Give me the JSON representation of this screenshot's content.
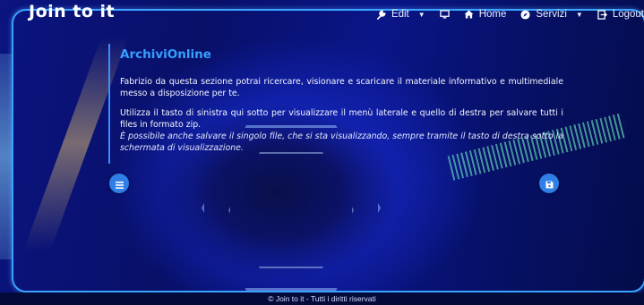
{
  "brand": {
    "name": "Join to it"
  },
  "navbar": {
    "items": [
      {
        "label": "Edit",
        "icon": "wrench-icon",
        "dropdown": true
      },
      {
        "label": "",
        "icon": "monitor-icon",
        "dropdown": false
      },
      {
        "label": "Home",
        "icon": "home-icon",
        "dropdown": false
      },
      {
        "label": "Servizi",
        "icon": "compass-icon",
        "dropdown": true
      },
      {
        "label": "Logout",
        "icon": "logout-icon",
        "dropdown": false
      }
    ]
  },
  "content": {
    "title": "ArchiviOnline",
    "paragraph1": "Fabrizio da questa sezione potrai ricercare, visionare e scaricare il materiale informativo e multimediale messo a disposizione per te.",
    "paragraph2": "Utilizza il tasto di sinistra qui sotto per visualizzare il menù laterale e quello di destra per salvare tutti i files in formato zip.",
    "paragraph3": "È possibile anche salvare il singolo file, che si sta visualizzando, sempre tramite il tasto di destra sotto la schermata di visualizzazione."
  },
  "buttons": {
    "left": {
      "icon": "menu-icon"
    },
    "right": {
      "icon": "save-icon"
    }
  },
  "footer": {
    "text": "© Join to it - Tutti i diritti riservati"
  },
  "colors": {
    "accent": "#35a0ff",
    "frame": "#3aa3ff",
    "button": "#2f7fe6",
    "background": "#0a1588"
  }
}
